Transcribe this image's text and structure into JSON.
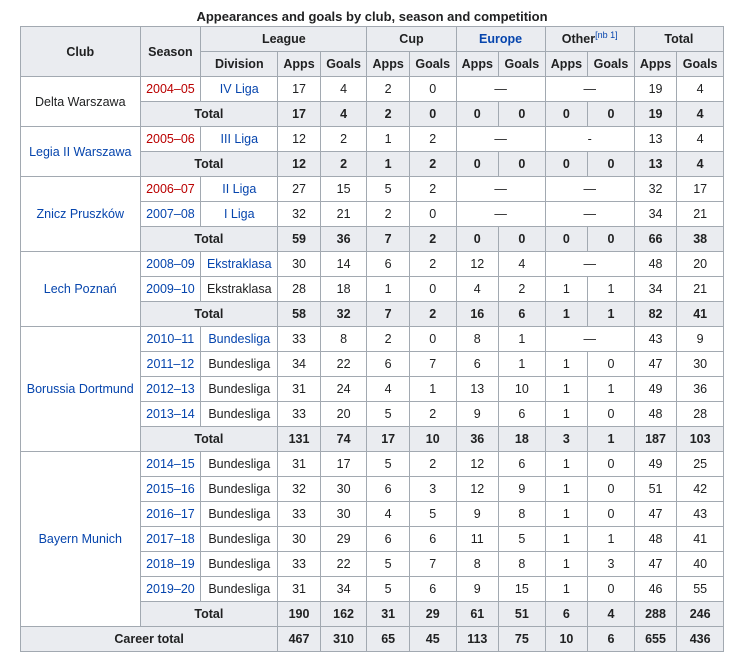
{
  "caption": "Appearances and goals by club, season and competition",
  "headers": {
    "club": "Club",
    "season": "Season",
    "league": "League",
    "cup": "Cup",
    "europe": "Europe",
    "other": "Other",
    "other_note": "[nb 1]",
    "total": "Total",
    "division": "Division",
    "apps": "Apps",
    "goals": "Goals"
  },
  "clubs": [
    {
      "name": "Delta Warszawa",
      "link": false,
      "seasons": [
        {
          "season": "2004–05",
          "season_style": "red",
          "division": "IV Liga",
          "division_style": "blue",
          "cells": [
            "17",
            "4",
            "2",
            "0",
            "—",
            "—",
            "19",
            "4"
          ]
        }
      ],
      "total": [
        "17",
        "4",
        "2",
        "0",
        "0",
        "0",
        "0",
        "0",
        "19",
        "4"
      ]
    },
    {
      "name": "Legia II Warszawa",
      "link": true,
      "seasons": [
        {
          "season": "2005–06",
          "season_style": "red",
          "division": "III Liga",
          "division_style": "blue",
          "cells": [
            "12",
            "2",
            "1",
            "2",
            "—",
            "-",
            "13",
            "4"
          ]
        }
      ],
      "total": [
        "12",
        "2",
        "1",
        "2",
        "0",
        "0",
        "0",
        "0",
        "13",
        "4"
      ]
    },
    {
      "name": "Znicz Pruszków",
      "link": true,
      "seasons": [
        {
          "season": "2006–07",
          "season_style": "red",
          "division": "II Liga",
          "division_style": "blue",
          "cells": [
            "27",
            "15",
            "5",
            "2",
            "—",
            "—",
            "32",
            "17"
          ]
        },
        {
          "season": "2007–08",
          "season_style": "blue",
          "division": "I Liga",
          "division_style": "blue",
          "cells": [
            "32",
            "21",
            "2",
            "0",
            "—",
            "—",
            "34",
            "21"
          ]
        }
      ],
      "total": [
        "59",
        "36",
        "7",
        "2",
        "0",
        "0",
        "0",
        "0",
        "66",
        "38"
      ]
    },
    {
      "name": "Lech Poznań",
      "link": true,
      "seasons": [
        {
          "season": "2008–09",
          "season_style": "blue",
          "division": "Ekstraklasa",
          "division_style": "blue",
          "cells": [
            "30",
            "14",
            "6",
            "2",
            "12",
            "4",
            "—",
            "48",
            "20"
          ]
        },
        {
          "season": "2009–10",
          "season_style": "blue",
          "division": "Ekstraklasa",
          "division_style": "plain",
          "cells": [
            "28",
            "18",
            "1",
            "0",
            "4",
            "2",
            "1",
            "1",
            "34",
            "21"
          ]
        }
      ],
      "total": [
        "58",
        "32",
        "7",
        "2",
        "16",
        "6",
        "1",
        "1",
        "82",
        "41"
      ]
    },
    {
      "name": "Borussia Dortmund",
      "link": true,
      "seasons": [
        {
          "season": "2010–11",
          "season_style": "blue",
          "division": "Bundesliga",
          "division_style": "blue",
          "cells": [
            "33",
            "8",
            "2",
            "0",
            "8",
            "1",
            "—",
            "43",
            "9"
          ]
        },
        {
          "season": "2011–12",
          "season_style": "blue",
          "division": "Bundesliga",
          "division_style": "plain",
          "cells": [
            "34",
            "22",
            "6",
            "7",
            "6",
            "1",
            "1",
            "0",
            "47",
            "30"
          ]
        },
        {
          "season": "2012–13",
          "season_style": "blue",
          "division": "Bundesliga",
          "division_style": "plain",
          "cells": [
            "31",
            "24",
            "4",
            "1",
            "13",
            "10",
            "1",
            "1",
            "49",
            "36"
          ]
        },
        {
          "season": "2013–14",
          "season_style": "blue",
          "division": "Bundesliga",
          "division_style": "plain",
          "cells": [
            "33",
            "20",
            "5",
            "2",
            "9",
            "6",
            "1",
            "0",
            "48",
            "28"
          ]
        }
      ],
      "total": [
        "131",
        "74",
        "17",
        "10",
        "36",
        "18",
        "3",
        "1",
        "187",
        "103"
      ]
    },
    {
      "name": "Bayern Munich",
      "link": true,
      "seasons": [
        {
          "season": "2014–15",
          "season_style": "blue",
          "division": "Bundesliga",
          "division_style": "plain",
          "cells": [
            "31",
            "17",
            "5",
            "2",
            "12",
            "6",
            "1",
            "0",
            "49",
            "25"
          ]
        },
        {
          "season": "2015–16",
          "season_style": "blue",
          "division": "Bundesliga",
          "division_style": "plain",
          "cells": [
            "32",
            "30",
            "6",
            "3",
            "12",
            "9",
            "1",
            "0",
            "51",
            "42"
          ]
        },
        {
          "season": "2016–17",
          "season_style": "blue",
          "division": "Bundesliga",
          "division_style": "plain",
          "cells": [
            "33",
            "30",
            "4",
            "5",
            "9",
            "8",
            "1",
            "0",
            "47",
            "43"
          ]
        },
        {
          "season": "2017–18",
          "season_style": "blue",
          "division": "Bundesliga",
          "division_style": "plain",
          "cells": [
            "30",
            "29",
            "6",
            "6",
            "11",
            "5",
            "1",
            "1",
            "48",
            "41"
          ]
        },
        {
          "season": "2018–19",
          "season_style": "blue",
          "division": "Bundesliga",
          "division_style": "plain",
          "cells": [
            "33",
            "22",
            "5",
            "7",
            "8",
            "8",
            "1",
            "3",
            "47",
            "40"
          ]
        },
        {
          "season": "2019–20",
          "season_style": "blue",
          "division": "Bundesliga",
          "division_style": "plain",
          "cells": [
            "31",
            "34",
            "5",
            "6",
            "9",
            "15",
            "1",
            "0",
            "46",
            "55"
          ]
        }
      ],
      "total": [
        "190",
        "162",
        "31",
        "29",
        "61",
        "51",
        "6",
        "4",
        "288",
        "246"
      ]
    }
  ],
  "total_label": "Total",
  "career_label": "Career total",
  "career": [
    "467",
    "310",
    "65",
    "45",
    "113",
    "75",
    "10",
    "6",
    "655",
    "436"
  ],
  "colors": {
    "red_link": "#ba0000",
    "blue_link": "#0645ad",
    "header_bg": "#eaecf0",
    "border": "#a2a9b1"
  }
}
